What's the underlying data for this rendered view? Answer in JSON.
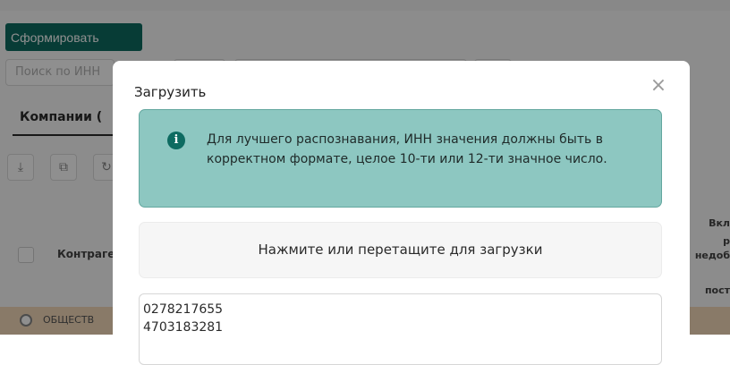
{
  "page": {
    "generate_button": "Сформировать",
    "search_placeholder": "Поиск по ИНН",
    "tab_companies": "Компании (",
    "table": {
      "column_counterparty": "Контраге",
      "column_right_line1": "Вкл",
      "column_right_line2": "р",
      "column_right_line3": "недоб",
      "column_right_line4": "пост",
      "row1_text": "ОБЩЕСТВ"
    }
  },
  "modal": {
    "title": "Загрузить",
    "close_glyph": "×",
    "alert": {
      "icon_glyph": "i",
      "text": "Для лучшего распознавания, ИНН значения должны быть в корректном формате, целое 10-ти или 12-ти значное число."
    },
    "dropzone_label": "Нажмите или перетащите для загрузки",
    "textarea_lines": [
      "0278217655",
      "4703183281"
    ]
  },
  "colors": {
    "accent": "#0d6b61",
    "alert_bg": "#8dc7c1",
    "row_highlight": "#f5d9ba"
  },
  "icons": {
    "download": "download-icon",
    "copy": "copy-icon",
    "refresh": "refresh-icon",
    "info": "info-icon",
    "close": "close-icon"
  }
}
